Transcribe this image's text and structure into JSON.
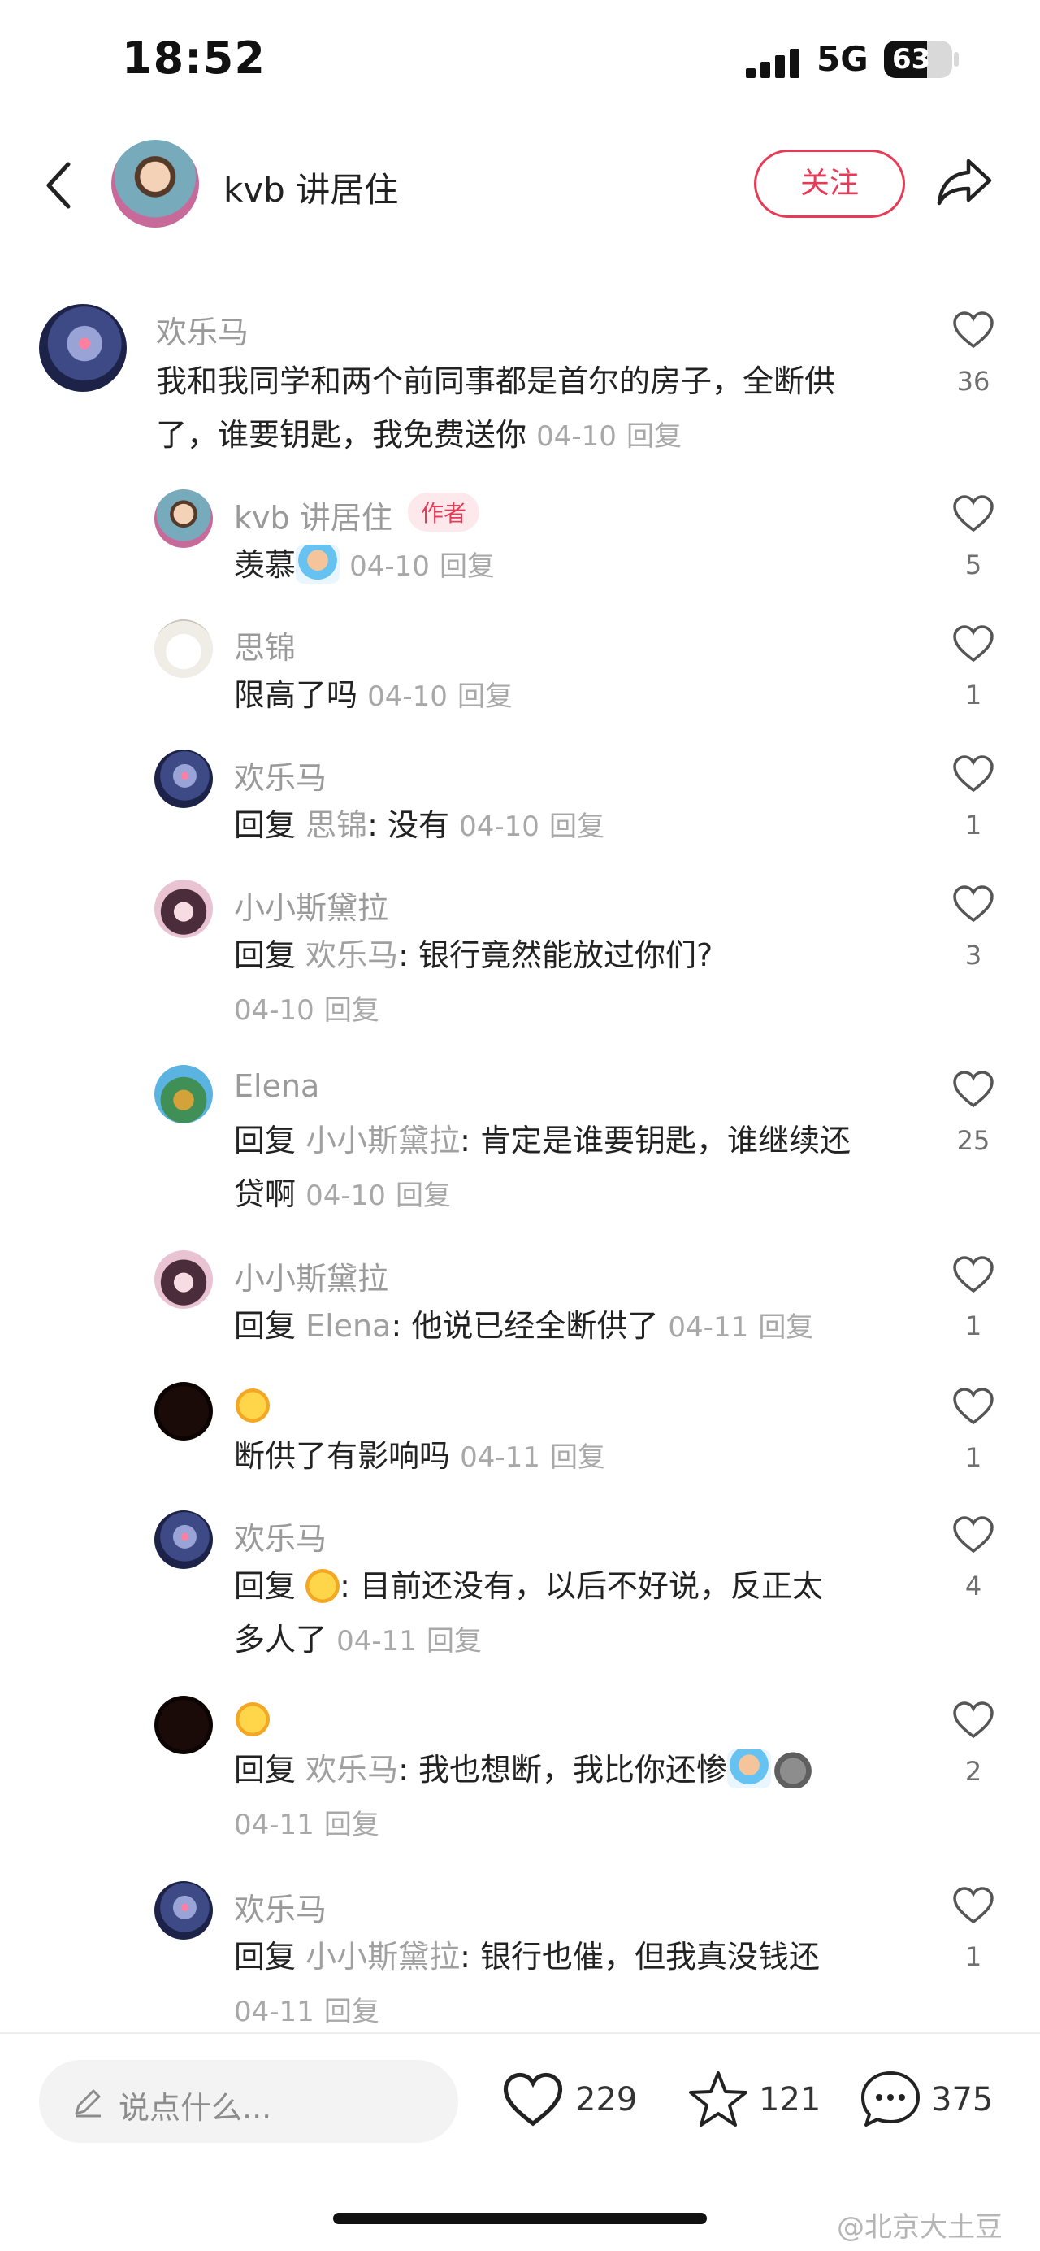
{
  "status_bar": {
    "time": "18:52",
    "network": "5G",
    "battery": "63",
    "battery_level": 0.63
  },
  "header": {
    "title": "kvb 讲居住",
    "follow_label": "关注"
  },
  "comments": [
    {
      "name": "欢乐马",
      "text": "我和我同学和两个前同事都是首尔的房子，全断供",
      "text2": "了，谁要钥匙，我免费送你",
      "date": "04-10",
      "reply_label": "回复",
      "likes": "36"
    },
    {
      "name": "kvb 讲居住",
      "badge": "作者",
      "text": "羡慕",
      "date": "04-10",
      "reply_label": "回复",
      "likes": "5"
    },
    {
      "name": "思锦",
      "text": "限高了吗",
      "date": "04-10",
      "reply_label": "回复",
      "likes": "1"
    },
    {
      "name": "欢乐马",
      "prefix": "回复",
      "reply_to": "思锦",
      "text": ": 没有",
      "date": "04-10",
      "reply_label": "回复",
      "likes": "1"
    },
    {
      "name": "小小斯黛拉",
      "prefix": "回复",
      "reply_to": "欢乐马",
      "text": ": 银行竟然能放过你们?",
      "date": "04-10",
      "reply_label": "回复",
      "likes": "3"
    },
    {
      "name": "Elena",
      "prefix": "回复",
      "reply_to": "小小斯黛拉",
      "text": ": 肯定是谁要钥匙，谁继续还",
      "text2": "贷啊",
      "date": "04-10",
      "reply_label": "回复",
      "likes": "25"
    },
    {
      "name": "小小斯黛拉",
      "prefix": "回复",
      "reply_to": "Elena",
      "text": ": 他说已经全断供了",
      "date": "04-11",
      "reply_label": "回复",
      "likes": "1"
    },
    {
      "name": "",
      "text": "断供了有影响吗",
      "date": "04-11",
      "reply_label": "回复",
      "likes": "1"
    },
    {
      "name": "欢乐马",
      "prefix": "回复",
      "reply_to": "",
      "text": ": 目前还没有，以后不好说，反正太",
      "text2": "多人了",
      "date": "04-11",
      "reply_label": "回复",
      "likes": "4"
    },
    {
      "name": "",
      "prefix": "回复",
      "reply_to": "欢乐马",
      "text": ": 我也想断，我比你还惨",
      "date": "04-11",
      "reply_label": "回复",
      "likes": "2"
    },
    {
      "name": "欢乐马",
      "prefix": "回复",
      "reply_to": "小小斯黛拉",
      "text": ": 银行也催，但我真没钱还",
      "date": "04-11",
      "reply_label": "回复",
      "likes": "1"
    }
  ],
  "bottom_bar": {
    "input_placeholder": "说点什么...",
    "likes": "229",
    "favorites": "121",
    "comments": "375"
  },
  "watermark": "@北京大土豆",
  "icons": [
    "back-icon",
    "share-icon",
    "heart-icon",
    "star-icon",
    "chat-icon",
    "pen-icon",
    "signal-icon",
    "battery-icon"
  ]
}
